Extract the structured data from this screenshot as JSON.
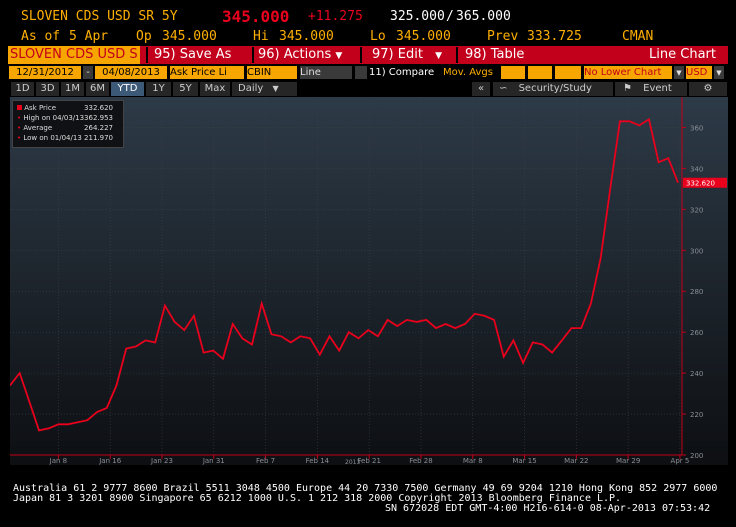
{
  "header": {
    "security": "SLOVEN CDS USD SR 5Y",
    "last": "345.000",
    "change": "+11.275",
    "bid": "325.000",
    "ask": "365.000",
    "asof_label": "As of",
    "asof": "5 Apr",
    "open_label": "Op",
    "open": "345.000",
    "high_label": "Hi",
    "high": "345.000",
    "low_label": "Lo",
    "low": "345.000",
    "prev_label": "Prev",
    "prev": "333.725",
    "source": "CMAN"
  },
  "toolbar": {
    "ticker": "SLOVEN CDS USD S",
    "save_as": "95) Save As",
    "actions": "96) Actions",
    "edit": "97) Edit",
    "table": "98) Table",
    "view": "Line Chart"
  },
  "fields": {
    "start_date": "12/31/2012",
    "dash": "-",
    "end_date": "04/08/2013",
    "price_field": "Ask Price Li",
    "source": "CBIN",
    "chart_type": "Line",
    "compare": "11) Compare",
    "mov_avgs": "Mov. Avgs",
    "lower_chart": "No Lower Chart",
    "currency": "USD"
  },
  "tabs": {
    "items": [
      "1D",
      "3D",
      "1M",
      "6M",
      "YTD",
      "1Y",
      "5Y",
      "Max",
      "Daily"
    ],
    "selected": "YTD",
    "collapse": "«",
    "security_study": "Security/Study",
    "event": "Event"
  },
  "legend": {
    "ask_price_label": "Ask Price",
    "ask_price": "332.620",
    "high_label": "High on 04/03/13",
    "high": "362.953",
    "average_label": "Average",
    "average": "264.227",
    "low_label": "Low on 01/04/13",
    "low": "211.970"
  },
  "chart_data": {
    "type": "line",
    "series": [
      {
        "name": "Ask Price",
        "color": "#e8001c",
        "values": [
          234,
          240,
          226,
          212,
          213,
          215,
          215,
          216,
          217,
          221,
          223,
          234,
          252,
          253,
          256,
          255,
          273,
          265,
          261,
          268,
          250,
          251,
          247,
          264,
          257,
          254,
          274,
          259,
          258,
          255,
          258,
          257,
          249,
          258,
          251,
          260,
          257,
          261,
          258,
          266,
          263,
          266,
          265,
          266,
          262,
          264,
          262,
          264,
          269,
          268,
          266,
          248,
          256,
          245,
          255,
          254,
          250,
          256,
          262,
          262,
          274,
          296,
          330,
          363,
          363,
          361,
          364,
          343,
          345,
          333
        ],
        "last_label": "332.620"
      }
    ],
    "x_tick_labels": [
      "Jan 8",
      "Jan 16",
      "Jan 23",
      "Jan 31",
      "Feb 7",
      "Feb 14",
      "Feb 21",
      "Feb 28",
      "Mar 8",
      "Mar 15",
      "Mar 22",
      "Mar 29",
      "Apr 5"
    ],
    "x_year_label": "2013",
    "y_tick_labels": [
      "200",
      "220",
      "240",
      "260",
      "280",
      "300",
      "320",
      "340",
      "360"
    ],
    "ylim": [
      200,
      370
    ],
    "grid": true,
    "axis_color": "#c3001b"
  },
  "footer": {
    "line1": "Australia 61 2 9777 8600 Brazil 5511 3048 4500 Europe 44 20 7330 7500 Germany 49 69 9204 1210 Hong Kong 852 2977 6000",
    "line2": "Japan 81 3 3201 8900         Singapore 65 6212 1000        U.S. 1 212 318 2000         Copyright 2013 Bloomberg Finance L.P.",
    "line3": "SN 672028 EDT  GMT-4:00 H216-614-0 08-Apr-2013 07:53:42"
  }
}
